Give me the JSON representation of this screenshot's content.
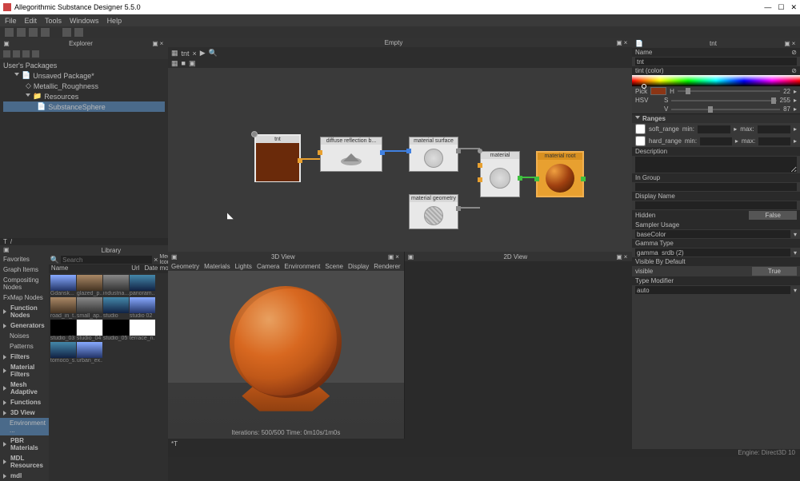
{
  "app": {
    "title": "Allegorithmic Substance Designer 5.5.0"
  },
  "menu": {
    "items": [
      "File",
      "Edit",
      "Tools",
      "Windows",
      "Help"
    ]
  },
  "explorer": {
    "title": "Explorer",
    "section": "User's Packages",
    "root": "Unsaved Package*",
    "items": [
      "Metallic_Roughness",
      "Resources",
      "SubstanceSphere"
    ]
  },
  "library": {
    "title": "Library",
    "search_placeholder": "Search",
    "view_mode": "Medium Icon",
    "columns": {
      "name": "Name",
      "url": "Url",
      "date": "Date modified"
    },
    "side": [
      {
        "label": "Favorites",
        "bold": false
      },
      {
        "label": "Graph Items",
        "bold": false
      },
      {
        "label": "Compositing Nodes",
        "bold": false
      },
      {
        "label": "FxMap Nodes",
        "bold": false
      },
      {
        "label": "Function Nodes",
        "bold": true
      },
      {
        "label": "Generators",
        "bold": true
      },
      {
        "label": "Noises",
        "bold": false,
        "indent": true
      },
      {
        "label": "Patterns",
        "bold": false,
        "indent": true
      },
      {
        "label": "Filters",
        "bold": true
      },
      {
        "label": "Material Filters",
        "bold": true
      },
      {
        "label": "Mesh Adaptive",
        "bold": true
      },
      {
        "label": "Functions",
        "bold": true
      },
      {
        "label": "3D View",
        "bold": true
      },
      {
        "label": "Environment ...",
        "bold": false,
        "sel": true,
        "indent": true
      },
      {
        "label": "PBR Materials",
        "bold": true
      },
      {
        "label": "MDL Resources",
        "bold": true
      },
      {
        "label": "mdl",
        "bold": true
      }
    ],
    "rows": [
      [
        "Gdansk...",
        "glazed_p...",
        "industria...",
        "panoram..."
      ],
      [
        "road_in_t...",
        "small_ap...",
        "studio",
        "studio 02"
      ],
      [
        "studio_03",
        "studio_04",
        "studio_05",
        "terrace_n..."
      ],
      [
        "tomoco_s...",
        "urban_ex...",
        "",
        ""
      ]
    ]
  },
  "graph": {
    "title": "Empty",
    "tab": "tnt",
    "nodes": {
      "tnt": "tnt",
      "diffuse": "diffuse reflection b...",
      "surface": "material surface",
      "geometry": "material geometry",
      "material": "material",
      "root": "material root"
    }
  },
  "view3d": {
    "title": "3D View",
    "menu": [
      "Geometry",
      "Materials",
      "Lights",
      "Camera",
      "Environment",
      "Scene",
      "Display",
      "Renderer"
    ],
    "status": "Iterations: 500/500    Time: 0m10s/1m0s"
  },
  "view2d": {
    "title": "2D View"
  },
  "properties": {
    "title": "tnt",
    "name_label": "Name",
    "name_value": "tnt",
    "tint_label": "tint (color)",
    "pick": "Pick",
    "hsv": "HSV",
    "h": {
      "label": "H",
      "val": "22"
    },
    "s": {
      "label": "S",
      "val": "255"
    },
    "v": {
      "label": "V",
      "val": "87"
    },
    "ranges": "Ranges",
    "soft_range": "soft_range",
    "hard_range": "hard_range",
    "min": "min:",
    "max": "max:",
    "description": "Description",
    "in_group": "In Group",
    "display_name": "Display Name",
    "hidden": "Hidden",
    "false": "False",
    "sampler_usage": "Sampler Usage",
    "sampler_val": "baseColor",
    "gamma_type": "Gamma Type",
    "gamma_val": "gamma  srdb (2)",
    "visible_default": "Visible By Default",
    "visible_val": "visible",
    "true": "True",
    "type_modifier": "Type Modifier",
    "type_val": "auto"
  },
  "statusbar": {
    "engine": "Engine: Direct3D 10"
  }
}
